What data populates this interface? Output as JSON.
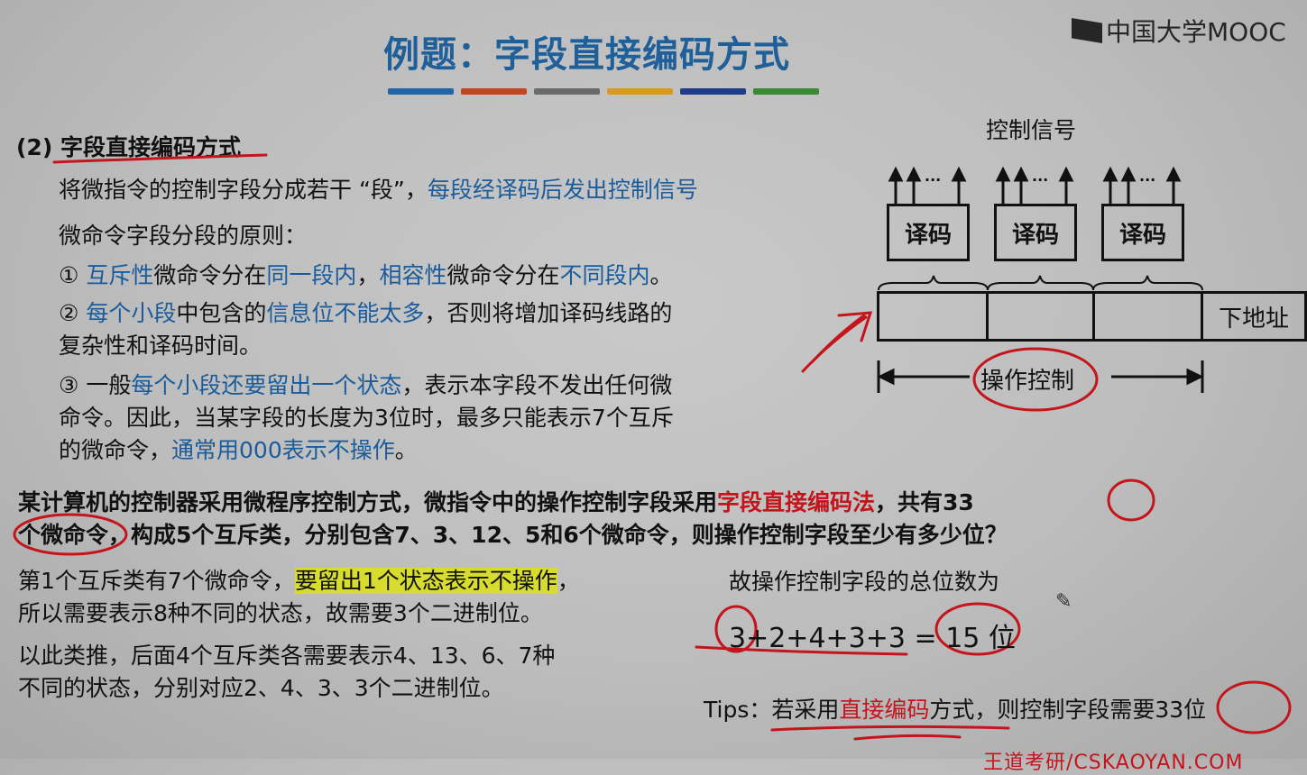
{
  "title": "例题：字段直接编码方式",
  "logo": "中国大学MOOC",
  "bar_colors": [
    "#2166a8",
    "#c5431f",
    "#6a6a6a",
    "#d99a1c",
    "#1f3c8c",
    "#3a8a35"
  ],
  "section_heading": "(2) 字段直接编码方式",
  "intro": {
    "text1": "将微指令的控制字段分成若干 “段”，",
    "text2": "每段经译码后发出控制信号"
  },
  "principles_title": "微命令字段分段的原则：",
  "principle1": {
    "num": "①",
    "a": "互斥性",
    "b": "微命令分在",
    "c": "同一段内",
    "d": "，",
    "e": "相容性",
    "f": "微命令分在",
    "g": "不同段内",
    "h": "。"
  },
  "principle2": {
    "num": "②",
    "a": "每个小段",
    "b": "中包含的",
    "c": "信息位不能太多",
    "d": "，否则将增加译码线路的",
    "line2": "复杂性和译码时间。"
  },
  "principle3": {
    "num": "③",
    "a": "一般",
    "b": "每个小段还要留出一个状态",
    "c": "，表示本字段不发出任何微",
    "line2": "命令。因此，当某字段的长度为3位时，最多只能表示7个互斥",
    "line3a": "的微命令，",
    "line3b": "通常用000表示不操作",
    "line3c": "。"
  },
  "diagram": {
    "control_signal_label": "控制信号",
    "decoders": [
      "译码",
      "译码",
      "译码"
    ],
    "ellipsis": "···",
    "next_address_label": "下地址",
    "op_control_label": "操作控制"
  },
  "question": {
    "a": "某计算机的控制器采用微程序控制方式，微指令中的操作控制字段采用",
    "b": "字段直接编码法",
    "c": "，共有33",
    "line2": "个微命令，构成5个互斥类，分别包含7、3、12、5和6个微命令，则操作控制字段至少有多少位？"
  },
  "answer": {
    "l1a": "第1个互斥类有7个微命令，",
    "l1b": "要留出1个状态表示不操作",
    "l1c": "，",
    "l2": "所以需要表示8种不同的状态，故需要3个二进制位。",
    "l3": "以此类推，后面4个互斥类各需要表示4、13、6、7种",
    "l4": "不同的状态，分别对应2、4、3、3个二进制位。"
  },
  "total": {
    "label": "故操作控制字段的总位数为",
    "formula": "3+2+4+3+3 = 15 位"
  },
  "tips": {
    "a": "Tips：若采用",
    "b": "直接编码",
    "c": "方式，则控制字段需要33位"
  },
  "footer": "王道考研/CSKAOYAN.COM"
}
